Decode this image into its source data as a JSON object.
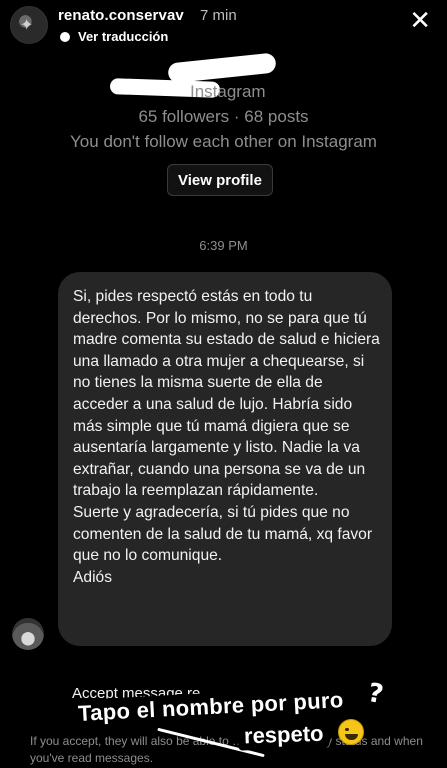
{
  "story_header": {
    "username": "renato.conservav",
    "time": "7 min",
    "translate_label": "Ver traducción"
  },
  "profile": {
    "source": "Instagram",
    "stats": "65 followers · 68 posts",
    "follow_note": "You don't follow each other on Instagram",
    "view_profile_label": "View profile"
  },
  "conversation": {
    "timestamp": "6:39 PM",
    "message": "Si, pides respectó estás en todo tu derechos. Por lo mismo, no se para que tú madre comenta su estado de salud e hiciera una llamado a otra mujer a chequearse, si no tienes la misma suerte de ella de acceder a una salud de lujo. Habría sido más simple que tú mamá digiera que se ausentaría largamente y listo. Nadie la va extrañar, cuando una persona se va de un trabajo la reemplazan rápidamente.\nSuerte y agradecería, si tú pides que no comenten de la salud de tu mamá, xq favor que no lo comunique.\nAdiós"
  },
  "request": {
    "title": "Accept message re",
    "note": "If you accept, they will also be able to … like your activity status and when you've read messages."
  },
  "story_caption": {
    "line1": "Tapo el nombre por puro",
    "line2": "respeto",
    "mark": "?"
  },
  "icons": {
    "close": "close-icon",
    "avatar": "avatar",
    "emoji": "laughing-face-emoji"
  }
}
